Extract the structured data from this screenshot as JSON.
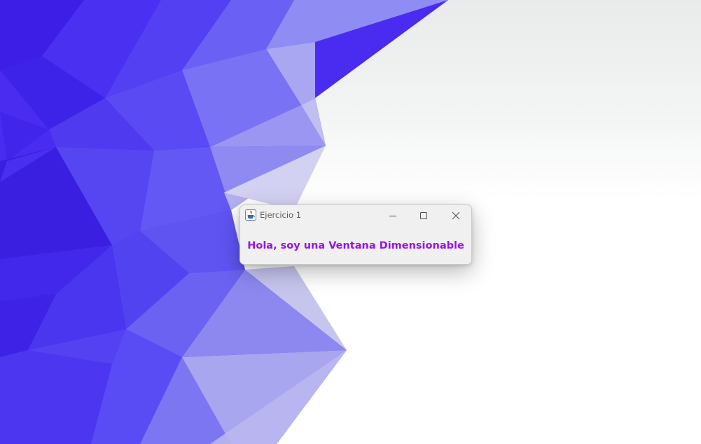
{
  "window": {
    "title": "Ejercicio 1",
    "app_icon": "java-cup-icon",
    "controls": {
      "minimize_icon": "minimize-icon",
      "maximize_icon": "maximize-icon",
      "close_icon": "close-icon"
    }
  },
  "content": {
    "message": "Hola, soy una Ventana Dimensionable",
    "message_color": "#9614e8"
  },
  "wallpaper": {
    "style": "low-poly blue geometric",
    "colors": [
      "#4020ea",
      "#5a4cf6",
      "#8a86f2",
      "#c4c3f1",
      "#ffffff"
    ]
  }
}
